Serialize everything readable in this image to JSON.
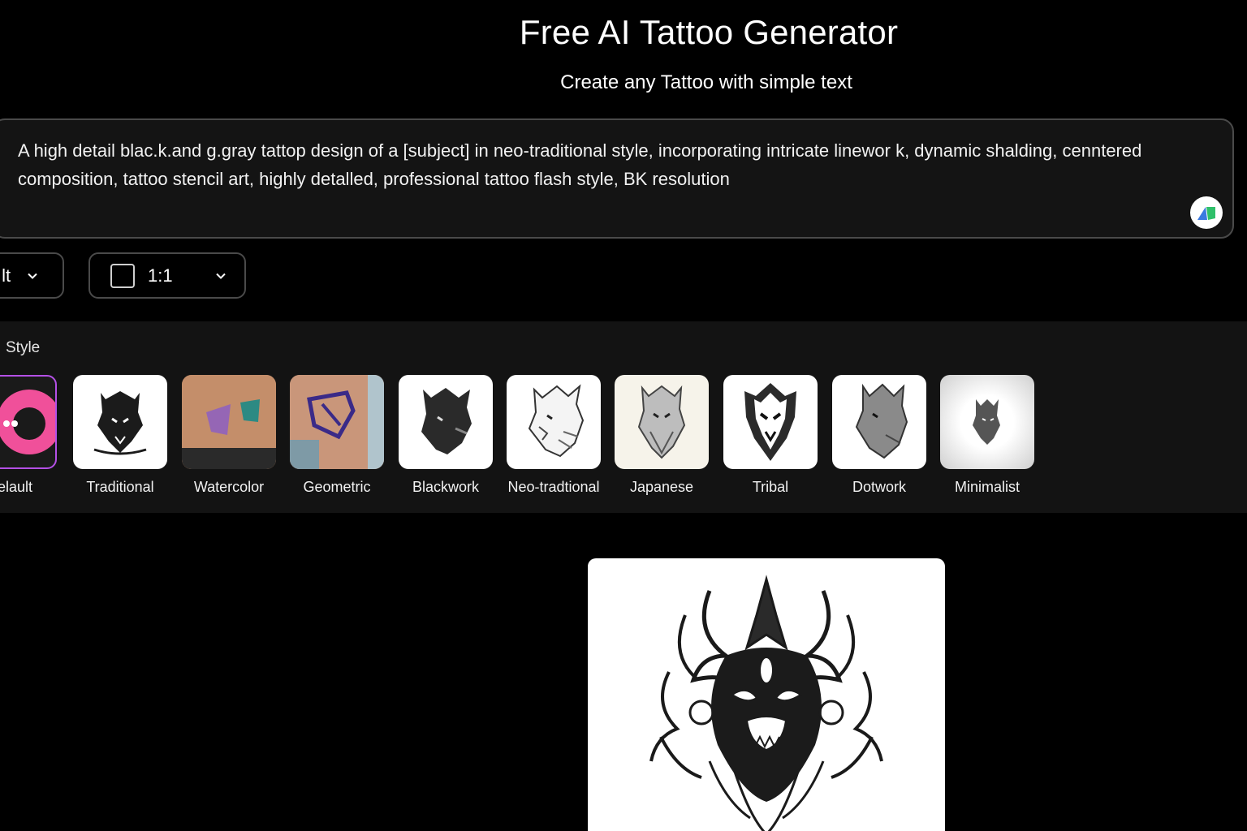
{
  "header": {
    "title": "Free AI Tattoo Generator",
    "subtitle": "Create any Tattoo with simple text"
  },
  "prompt": {
    "text": "A high detail blac.k.and g.gray tattop design of a [subject] in neo-traditional style, incorporating intricate linewor k, dynamic shalding, cenntered composition, tattoo stencil art, highly detalled, professional tattoo flash style, BK resolution"
  },
  "controls": {
    "model_label": "ılt",
    "ratio_label": "1:1"
  },
  "styles": {
    "heading": "Style",
    "items": [
      {
        "label": "elault",
        "icon": "smiley-logo-icon"
      },
      {
        "label": "Traditional",
        "icon": "wolf-icon"
      },
      {
        "label": "Watercolor",
        "icon": "watercolor-tattoo-photo"
      },
      {
        "label": "Geometric",
        "icon": "geometric-tattoo-photo"
      },
      {
        "label": "Blackwork",
        "icon": "wolf-icon"
      },
      {
        "label": "Neo-tradtional",
        "icon": "wolf-icon"
      },
      {
        "label": "Japanese",
        "icon": "wolf-icon"
      },
      {
        "label": "Tribal",
        "icon": "wolf-icon"
      },
      {
        "label": "Dotwork",
        "icon": "wolf-icon"
      },
      {
        "label": "Minimalist",
        "icon": "wolf-icon"
      }
    ]
  },
  "colors": {
    "background": "#000000",
    "prompt_bg": "#141414",
    "panel_bg": "#131313",
    "accent_purple": "#b450e6",
    "accent_pink": "#f0509a"
  }
}
